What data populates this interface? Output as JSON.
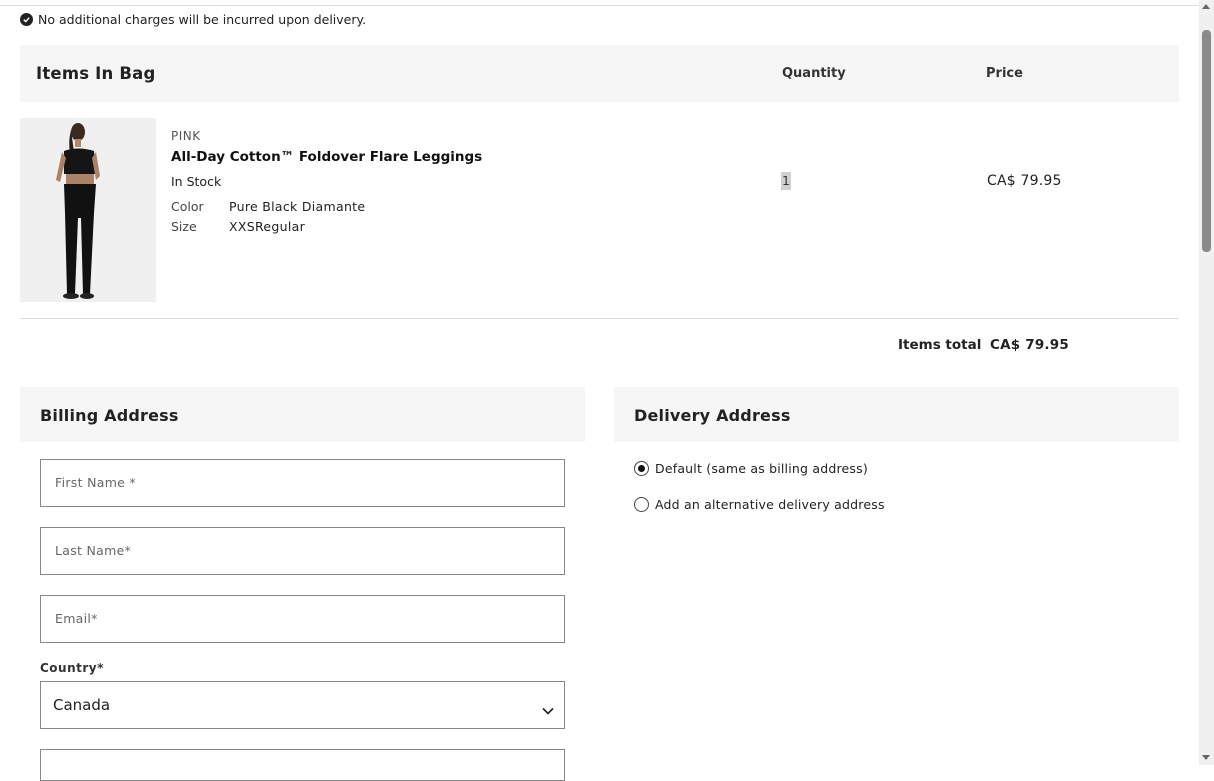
{
  "notice": {
    "icon": "check-circle-icon",
    "text": "No additional charges will be incurred upon delivery."
  },
  "bag": {
    "title": "Items In Bag",
    "col_quantity": "Quantity",
    "col_price": "Price",
    "item": {
      "brand": "PINK",
      "name": "All-Day Cotton™ Foldover Flare Leggings",
      "stock": "In Stock",
      "color_label": "Color",
      "color_value": "Pure Black Diamante",
      "size_label": "Size",
      "size_value": "XXSRegular",
      "quantity": "1",
      "price": "CA$ 79.95"
    },
    "total_label": "Items total",
    "total_value": "CA$ 79.95"
  },
  "billing": {
    "title": "Billing Address",
    "first_name_placeholder": "First Name *",
    "last_name_placeholder": "Last Name*",
    "email_placeholder": "Email*",
    "country_label": "Country*",
    "country_value": "Canada"
  },
  "delivery": {
    "title": "Delivery Address",
    "options": [
      {
        "label": "Default (same as billing address)",
        "selected": true
      },
      {
        "label": "Add an alternative delivery address",
        "selected": false
      }
    ]
  }
}
